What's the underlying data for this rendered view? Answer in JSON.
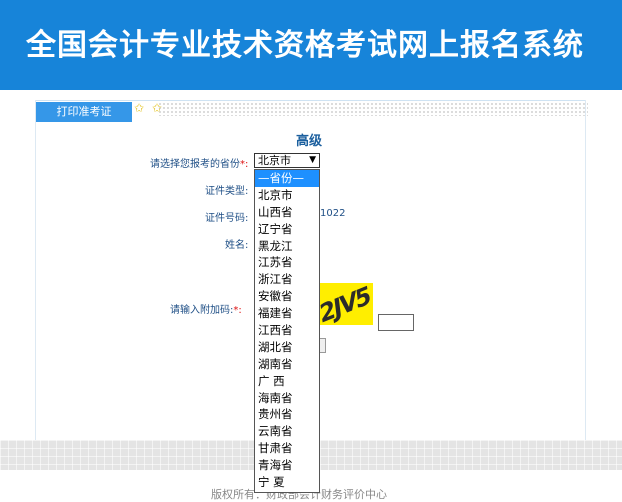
{
  "header": {
    "title": "全国会计专业技术资格考试网上报名系统"
  },
  "tab": {
    "label": "打印准考证"
  },
  "stars": "✩ ✩",
  "form": {
    "section_title": "高级",
    "province_label": "请选择您报考的省份",
    "required_mark": "*:",
    "province_value": "北京市",
    "cert_type_label": "证件类型:",
    "cert_no_label": "证件号码:",
    "cert_no_tail": "1022",
    "name_label": "姓名:",
    "captcha_label": "请输入附加码:",
    "captcha_text": "2JV5"
  },
  "dropdown": {
    "options": [
      "—省份—",
      "北京市",
      "山西省",
      "辽宁省",
      "黑龙江",
      "江苏省",
      "浙江省",
      "安徽省",
      "福建省",
      "江西省",
      "湖北省",
      "湖南省",
      "广 西",
      "海南省",
      "贵州省",
      "云南省",
      "甘肃省",
      "青海省",
      "宁 夏"
    ],
    "selected_index": 0
  },
  "footer": {
    "copyright": "版权所有：财政部会计财务评价中心"
  },
  "colors": {
    "header_bg": "#1784d9",
    "tab_bg": "#3597e8",
    "selected_option": "#1e90ff",
    "captcha_bg": "#ffee00"
  }
}
